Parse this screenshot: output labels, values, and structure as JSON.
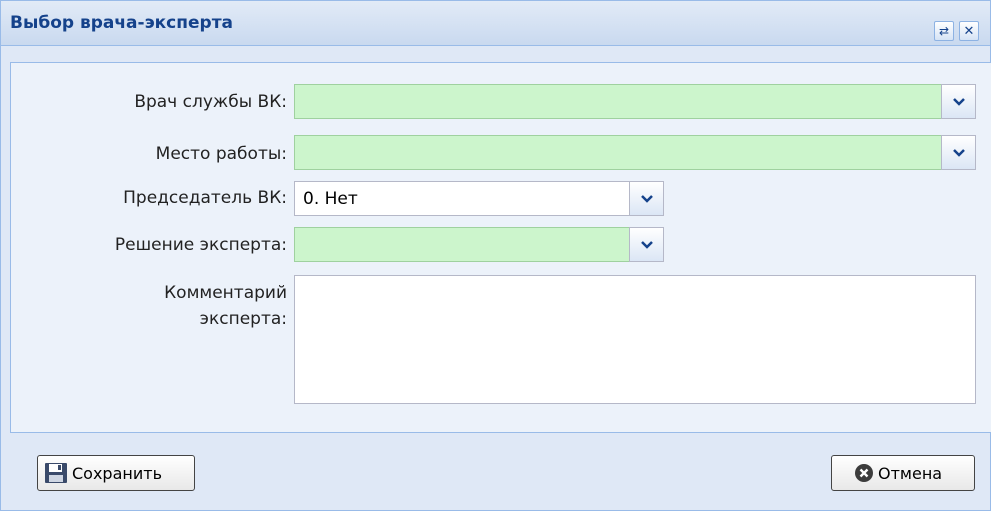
{
  "window": {
    "title": "Выбор врача-эксперта",
    "tools": {
      "refresh_icon": "refresh-icon",
      "close_icon": "close-icon"
    }
  },
  "form": {
    "doctor": {
      "label": "Врач службы ВК:",
      "value": ""
    },
    "workplace": {
      "label": "Место работы:",
      "value": ""
    },
    "chairman": {
      "label": "Председатель ВК:",
      "value": "0. Нет"
    },
    "decision": {
      "label": "Решение эксперта:",
      "value": ""
    },
    "comment": {
      "label_line1": "Комментарий",
      "label_line2": "эксперта:",
      "value": ""
    }
  },
  "buttons": {
    "save": {
      "label": "Сохранить",
      "icon": "floppy-disk-icon"
    },
    "cancel": {
      "label": "Отмена",
      "icon": "cancel-circle-icon"
    }
  },
  "colors": {
    "required_field_bg": "#ccf5cc",
    "title_color": "#15428b",
    "window_bg": "#dfe8f6"
  }
}
